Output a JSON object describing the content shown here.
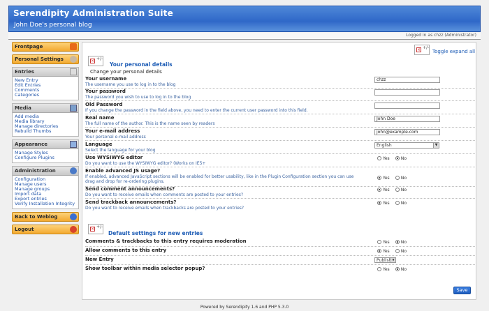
{
  "header": {
    "title": "Serendipity Administration Suite",
    "subtitle": "John Doe's personal blog"
  },
  "userbar": {
    "text": "Logged in as chzz (Administrator)"
  },
  "sidebar": {
    "frontpage": "Frontpage",
    "personal_settings": "Personal Settings",
    "entries": {
      "title": "Entries",
      "links": [
        "New Entry",
        "Edit Entries",
        "Comments",
        "Categories"
      ]
    },
    "media": {
      "title": "Media",
      "links": [
        "Add media",
        "Media library",
        "Manage directories",
        "Rebuild Thumbs"
      ]
    },
    "appearance": {
      "title": "Appearance",
      "links": [
        "Manage Styles",
        "Configure Plugins"
      ]
    },
    "administration": {
      "title": "Administration",
      "links": [
        "Configuration",
        "Manage users",
        "Manage groups",
        "Import data",
        "Export entries",
        "Verify Installation Integrity"
      ]
    },
    "back_to_weblog": "Back to Weblog",
    "logout": "Logout"
  },
  "main": {
    "toggle_label": "Toggle expand all",
    "personal": {
      "title": "Your personal details",
      "subtitle": "Change your personal details",
      "rows": [
        {
          "label": "Your username",
          "desc": "The username you use to log in to the blog",
          "value": "chzz"
        },
        {
          "label": "Your password",
          "desc": "The password you wish to use to log in to the blog",
          "value": ""
        },
        {
          "label": "Old Password",
          "desc": "If you change the password in the field above, you need to enter the current user password into this field.",
          "value": ""
        },
        {
          "label": "Real name",
          "desc": "The full name of the author. This is the name seen by readers",
          "value": "John Doe"
        },
        {
          "label": "Your e-mail address",
          "desc": "Your personal e-mail address",
          "value": "john@example.com"
        },
        {
          "label": "Language",
          "desc": "Select the language for your blog",
          "value": "English"
        },
        {
          "label": "Use WYSIWYG editor",
          "desc": "Do you want to use the WYSIWYG editor? (Works on IE5+",
          "yes": "Yes",
          "no": "No"
        },
        {
          "label": "Enable advanced JS usage?",
          "desc": "If enabled, advanced JavaScript sections will be enabled for better usability, like in the Plugin Configuration section you can use drag and drop for re-ordering plugins.",
          "yes": "Yes",
          "no": "No"
        },
        {
          "label": "Send comment announcements?",
          "desc": "Do you want to receive emails when comments are posted to your entries?",
          "yes": "Yes",
          "no": "No"
        },
        {
          "label": "Send trackback announcements?",
          "desc": "Do you want to receive emails when trackbacks are posted to your entries?",
          "yes": "Yes",
          "no": "No"
        }
      ]
    },
    "defaults": {
      "title": "Default settings for new entries",
      "rows": [
        {
          "label": "Comments & trackbacks to this entry requires moderation",
          "yes": "Yes",
          "no": "No"
        },
        {
          "label": "Allow comments to this entry",
          "yes": "Yes",
          "no": "No"
        },
        {
          "label": "New Entry",
          "value": "Publish"
        },
        {
          "label": "Show toolbar within media selector popup?",
          "yes": "Yes",
          "no": "No"
        }
      ]
    },
    "save_label": "Save"
  },
  "footer": {
    "text": "Powered by Serendipity 1.6 and PHP 5.3.0"
  }
}
